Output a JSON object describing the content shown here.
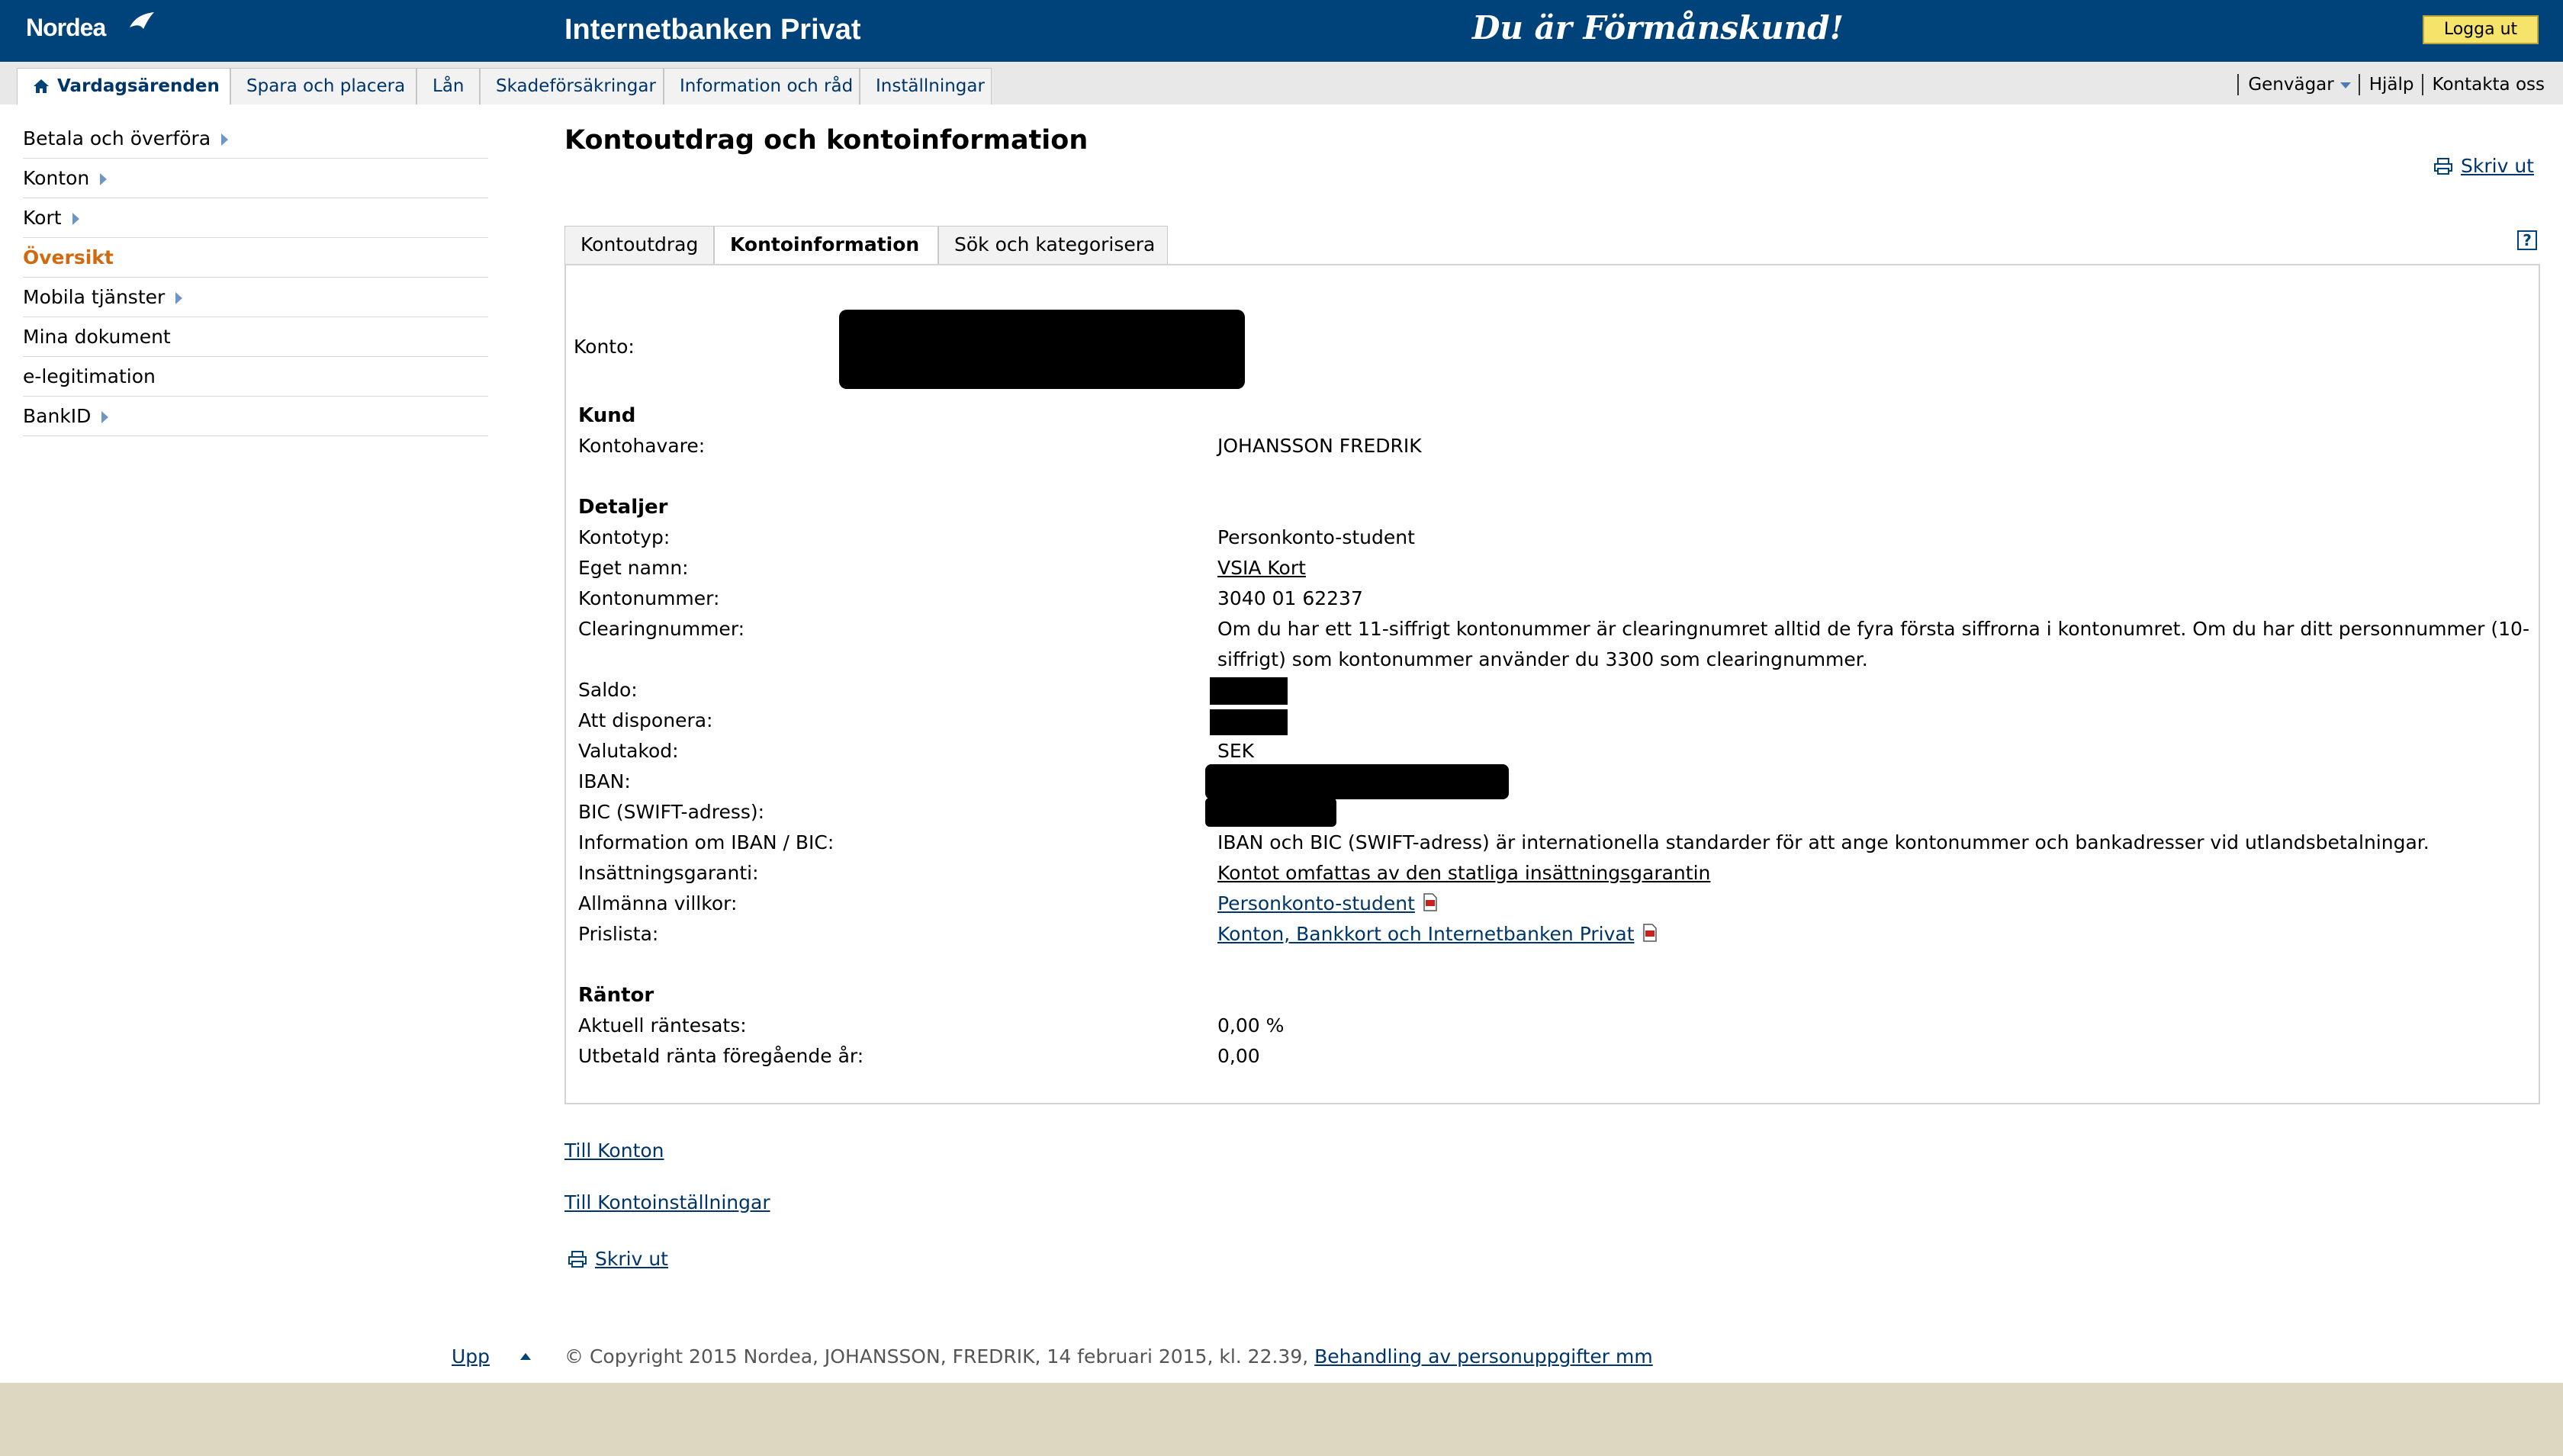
{
  "header": {
    "logo": "Nordea",
    "app_title": "Internetbanken Privat",
    "slogan": "Du är Förmånskund!",
    "logout": "Logga ut"
  },
  "nav": {
    "tabs": [
      {
        "label": "Vardagsärenden",
        "active": true
      },
      {
        "label": "Spara och placera"
      },
      {
        "label": "Lån"
      },
      {
        "label": "Skadeförsäkringar"
      },
      {
        "label": "Information och råd"
      },
      {
        "label": "Inställningar"
      }
    ],
    "quicklinks": [
      "Genvägar",
      "Hjälp",
      "Kontakta oss"
    ]
  },
  "sidebar": {
    "items": [
      {
        "label": "Betala och överföra",
        "arrow": true
      },
      {
        "label": "Konton",
        "arrow": true
      },
      {
        "label": "Kort",
        "arrow": true
      },
      {
        "label": "Översikt",
        "active": true
      },
      {
        "label": "Mobila tjänster",
        "arrow": true
      },
      {
        "label": "Mina dokument"
      },
      {
        "label": "e-legitimation"
      },
      {
        "label": "BankID",
        "arrow": true
      }
    ]
  },
  "main": {
    "title": "Kontoutdrag och kontoinformation",
    "print": "Skriv ut",
    "tabs": [
      "Kontoutdrag",
      "Kontoinformation",
      "Sök och kategorisera"
    ],
    "help": "?",
    "account_label": "Konto:",
    "sections": {
      "kund": "Kund",
      "detaljer": "Detaljer",
      "rantor": "Räntor"
    },
    "kund": {
      "kontohavare_label": "Kontohavare:",
      "kontohavare_value": "JOHANSSON FREDRIK"
    },
    "detaljer": {
      "kontotyp_label": "Kontotyp:",
      "kontotyp_value": "Personkonto-student",
      "eget_namn_label": "Eget namn:",
      "eget_namn_value": "VSIA Kort",
      "kontonummer_label": "Kontonummer:",
      "kontonummer_value": "3040 01 62237",
      "clearing_label": "Clearingnummer:",
      "clearing_line1": "Om du har ett 11-siffrigt kontonummer är clearingnumret alltid de fyra första siffrorna i kontonumret. Om du har ditt personnummer (10-",
      "clearing_line2": "siffrigt) som kontonummer använder du 3300 som clearingnummer.",
      "saldo_label": "Saldo:",
      "disponera_label": "Att disponera:",
      "valutakod_label": "Valutakod:",
      "valutakod_value": "SEK",
      "iban_label": "IBAN:",
      "bic_label": "BIC (SWIFT-adress):",
      "ibanbic_label": "Information om IBAN / BIC:",
      "ibanbic_value": "IBAN och BIC (SWIFT-adress) är internationella standarder för att ange kontonummer och bankadresser vid utlandsbetalningar.",
      "garanti_label": "Insättningsgaranti:",
      "garanti_value": "Kontot omfattas av den statliga insättningsgarantin",
      "villkor_label": "Allmänna villkor:",
      "villkor_value": "Personkonto-student",
      "prislista_label": "Prislista:",
      "prislista_value": "Konton, Bankkort och Internetbanken Privat"
    },
    "rantor": {
      "aktuell_label": "Aktuell räntesats:",
      "aktuell_value": "0,00 %",
      "utbetald_label": "Utbetald ränta föregående år:",
      "utbetald_value": "0,00"
    },
    "links": {
      "till_konton": "Till Konton",
      "till_installningar": "Till Kontoinställningar",
      "print_bottom": "Skriv ut"
    }
  },
  "footer": {
    "upp": "Upp",
    "copyright": "© Copyright 2015 Nordea, JOHANSSON, FREDRIK, 14 februari 2015, kl. 22.39,",
    "privacy_link": "Behandling av personuppgifter mm"
  },
  "colors": {
    "header_bg": "#00427a",
    "link": "#00356a",
    "active_menu": "#d06a10",
    "logout_bg": "#f5e36a",
    "footer_band": "#ddd7c2"
  }
}
